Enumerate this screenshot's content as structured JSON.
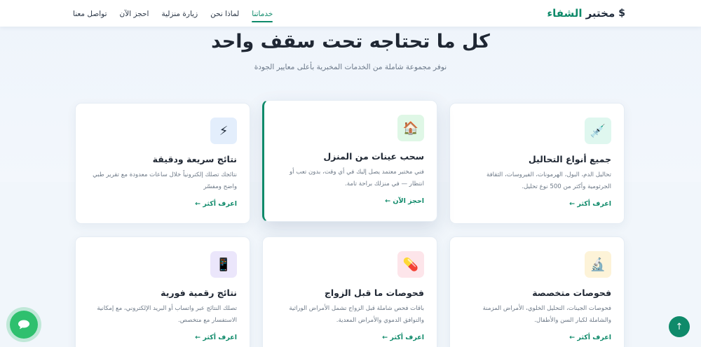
{
  "header": {
    "logo_prefix": "مختبر",
    "logo_accent": "الشفاء",
    "logo_icon": "$",
    "nav": [
      {
        "label": "خدماتنا",
        "active": true
      },
      {
        "label": "لماذا نحن",
        "active": false
      },
      {
        "label": "زيارة منزلية",
        "active": false
      },
      {
        "label": "احجز الآن",
        "active": false
      },
      {
        "label": "تواصل معنا",
        "active": false
      }
    ]
  },
  "section": {
    "title": "كل ما تحتاجه تحت سقف واحد",
    "subtitle": "نوفر مجموعة شاملة من الخدمات المخبرية بأعلى معايير الجودة"
  },
  "cards": [
    {
      "icon": "💉",
      "icon_name": "syringe-icon",
      "icon_bg": "#dff7ef",
      "title": "جميع أنواع التحاليل",
      "desc": "تحاليل الدم، البول، الهرمونات، الفيروسات، الثقافة الجرثومية وأكثر من 500 نوع تحليل.",
      "link": "اعرف أكثر ←"
    },
    {
      "icon": "🏠",
      "icon_name": "home-icon",
      "icon_bg": "#dff7e6",
      "title": "سحب عينات من المنزل",
      "desc": "فني مختبر معتمد يصل إليك في أي وقت، بدون تعب أو انتظار — في منزلك براحة تامة.",
      "link": "احجز الآن ←"
    },
    {
      "icon": "⚡",
      "icon_name": "lightning-icon",
      "icon_bg": "#e3eefc",
      "title": "نتائج سريعة ودقيقة",
      "desc": "نتائجك تصلك إلكترونياً خلال ساعات معدودة مع تقرير طبي واضح ومفسّر",
      "link": "اعرف أكثر ←"
    },
    {
      "icon": "🔬",
      "icon_name": "microscope-icon",
      "icon_bg": "#fdf3d8",
      "title": "فحوصات متخصصة",
      "desc": "فحوصات الجينات، التحليل الخلوي، الأمراض المزمنة والشاملة لكبار السن والأطفال.",
      "link": "اعرف أكثر ←"
    },
    {
      "icon": "💊",
      "icon_name": "pill-icon",
      "icon_bg": "#fde5ea",
      "title": "فحوصات ما قبل الزواج",
      "desc": "باقات فحص شاملة قبل الزواج تشمل الأمراض الوراثية والتوافق الدموي والأمراض المعدية.",
      "link": "اعرف أكثر ←"
    },
    {
      "icon": "📱",
      "icon_name": "phone-icon",
      "icon_bg": "#ebe6fb",
      "title": "نتائج رقمية فورية",
      "desc": "تصلك النتائج عبر واتساب أو البريد الإلكتروني، مع إمكانية الاستفسار مع متخصص.",
      "link": "اعرف أكثر ←"
    }
  ],
  "floating": {
    "chat_icon": "chat-icon",
    "top_label": "↑"
  }
}
